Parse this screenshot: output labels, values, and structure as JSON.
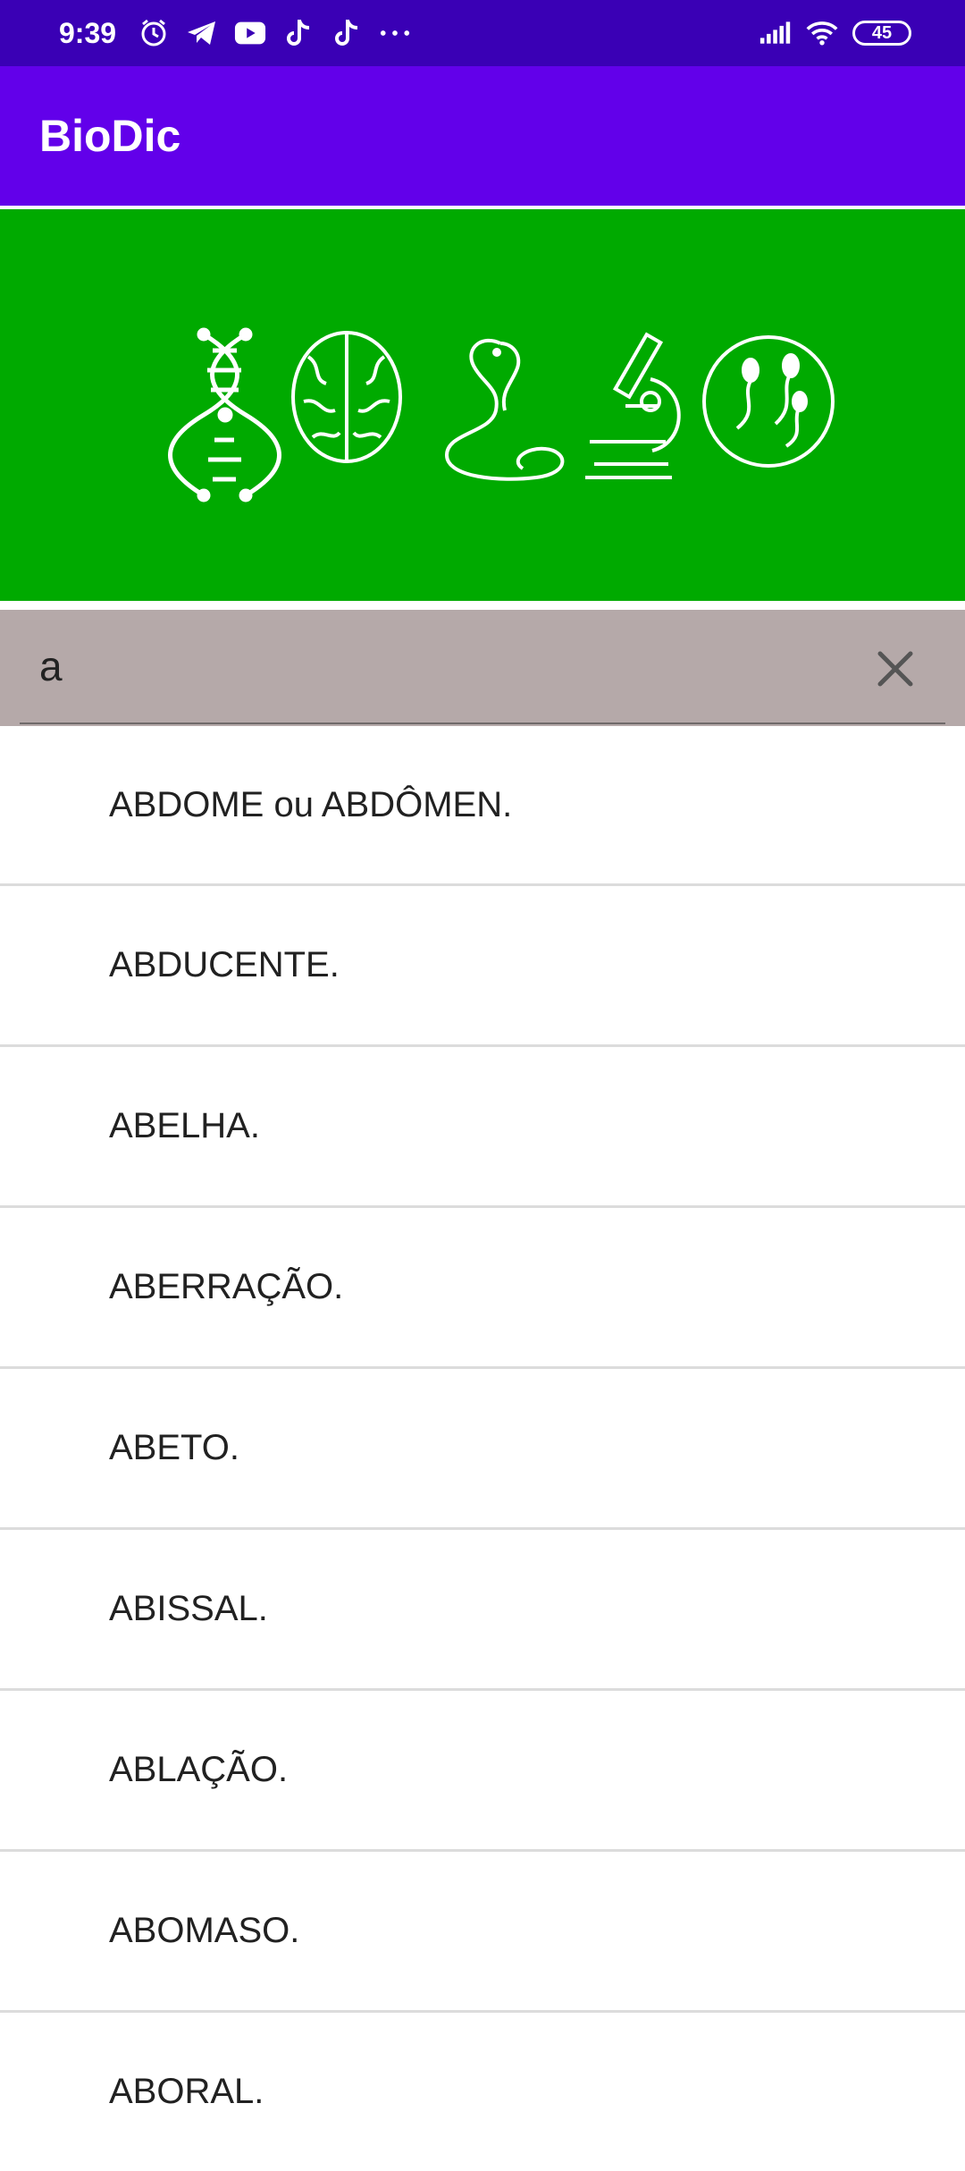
{
  "status_bar": {
    "time": "9:39",
    "battery": "45",
    "notification_icons": [
      "alarm-icon",
      "telegram-icon",
      "youtube-icon",
      "tiktok-icon",
      "tiktok-icon",
      "more-dots-icon"
    ],
    "system_icons": [
      "signal-icon",
      "wifi-icon",
      "battery-icon"
    ]
  },
  "app_bar": {
    "title": "BioDic"
  },
  "banner": {
    "background": "#00aa00",
    "icons": [
      "dna-icon",
      "brain-icon",
      "snake-icon",
      "microscope-icon",
      "sperm-cells-icon"
    ]
  },
  "search": {
    "value": "a",
    "clear_icon": "close-icon"
  },
  "list": {
    "items": [
      "ABDOME ou ABDÔMEN.",
      "ABDUCENTE.",
      "ABELHA.",
      "ABERRAÇÃO.",
      "ABETO.",
      "ABISSAL.",
      "ABLAÇÃO.",
      "ABOMASO.",
      "ABORAL."
    ]
  },
  "colors": {
    "status_bar": "#3a00b5",
    "app_bar": "#6200ea",
    "search_bg": "#b5a9a9"
  }
}
